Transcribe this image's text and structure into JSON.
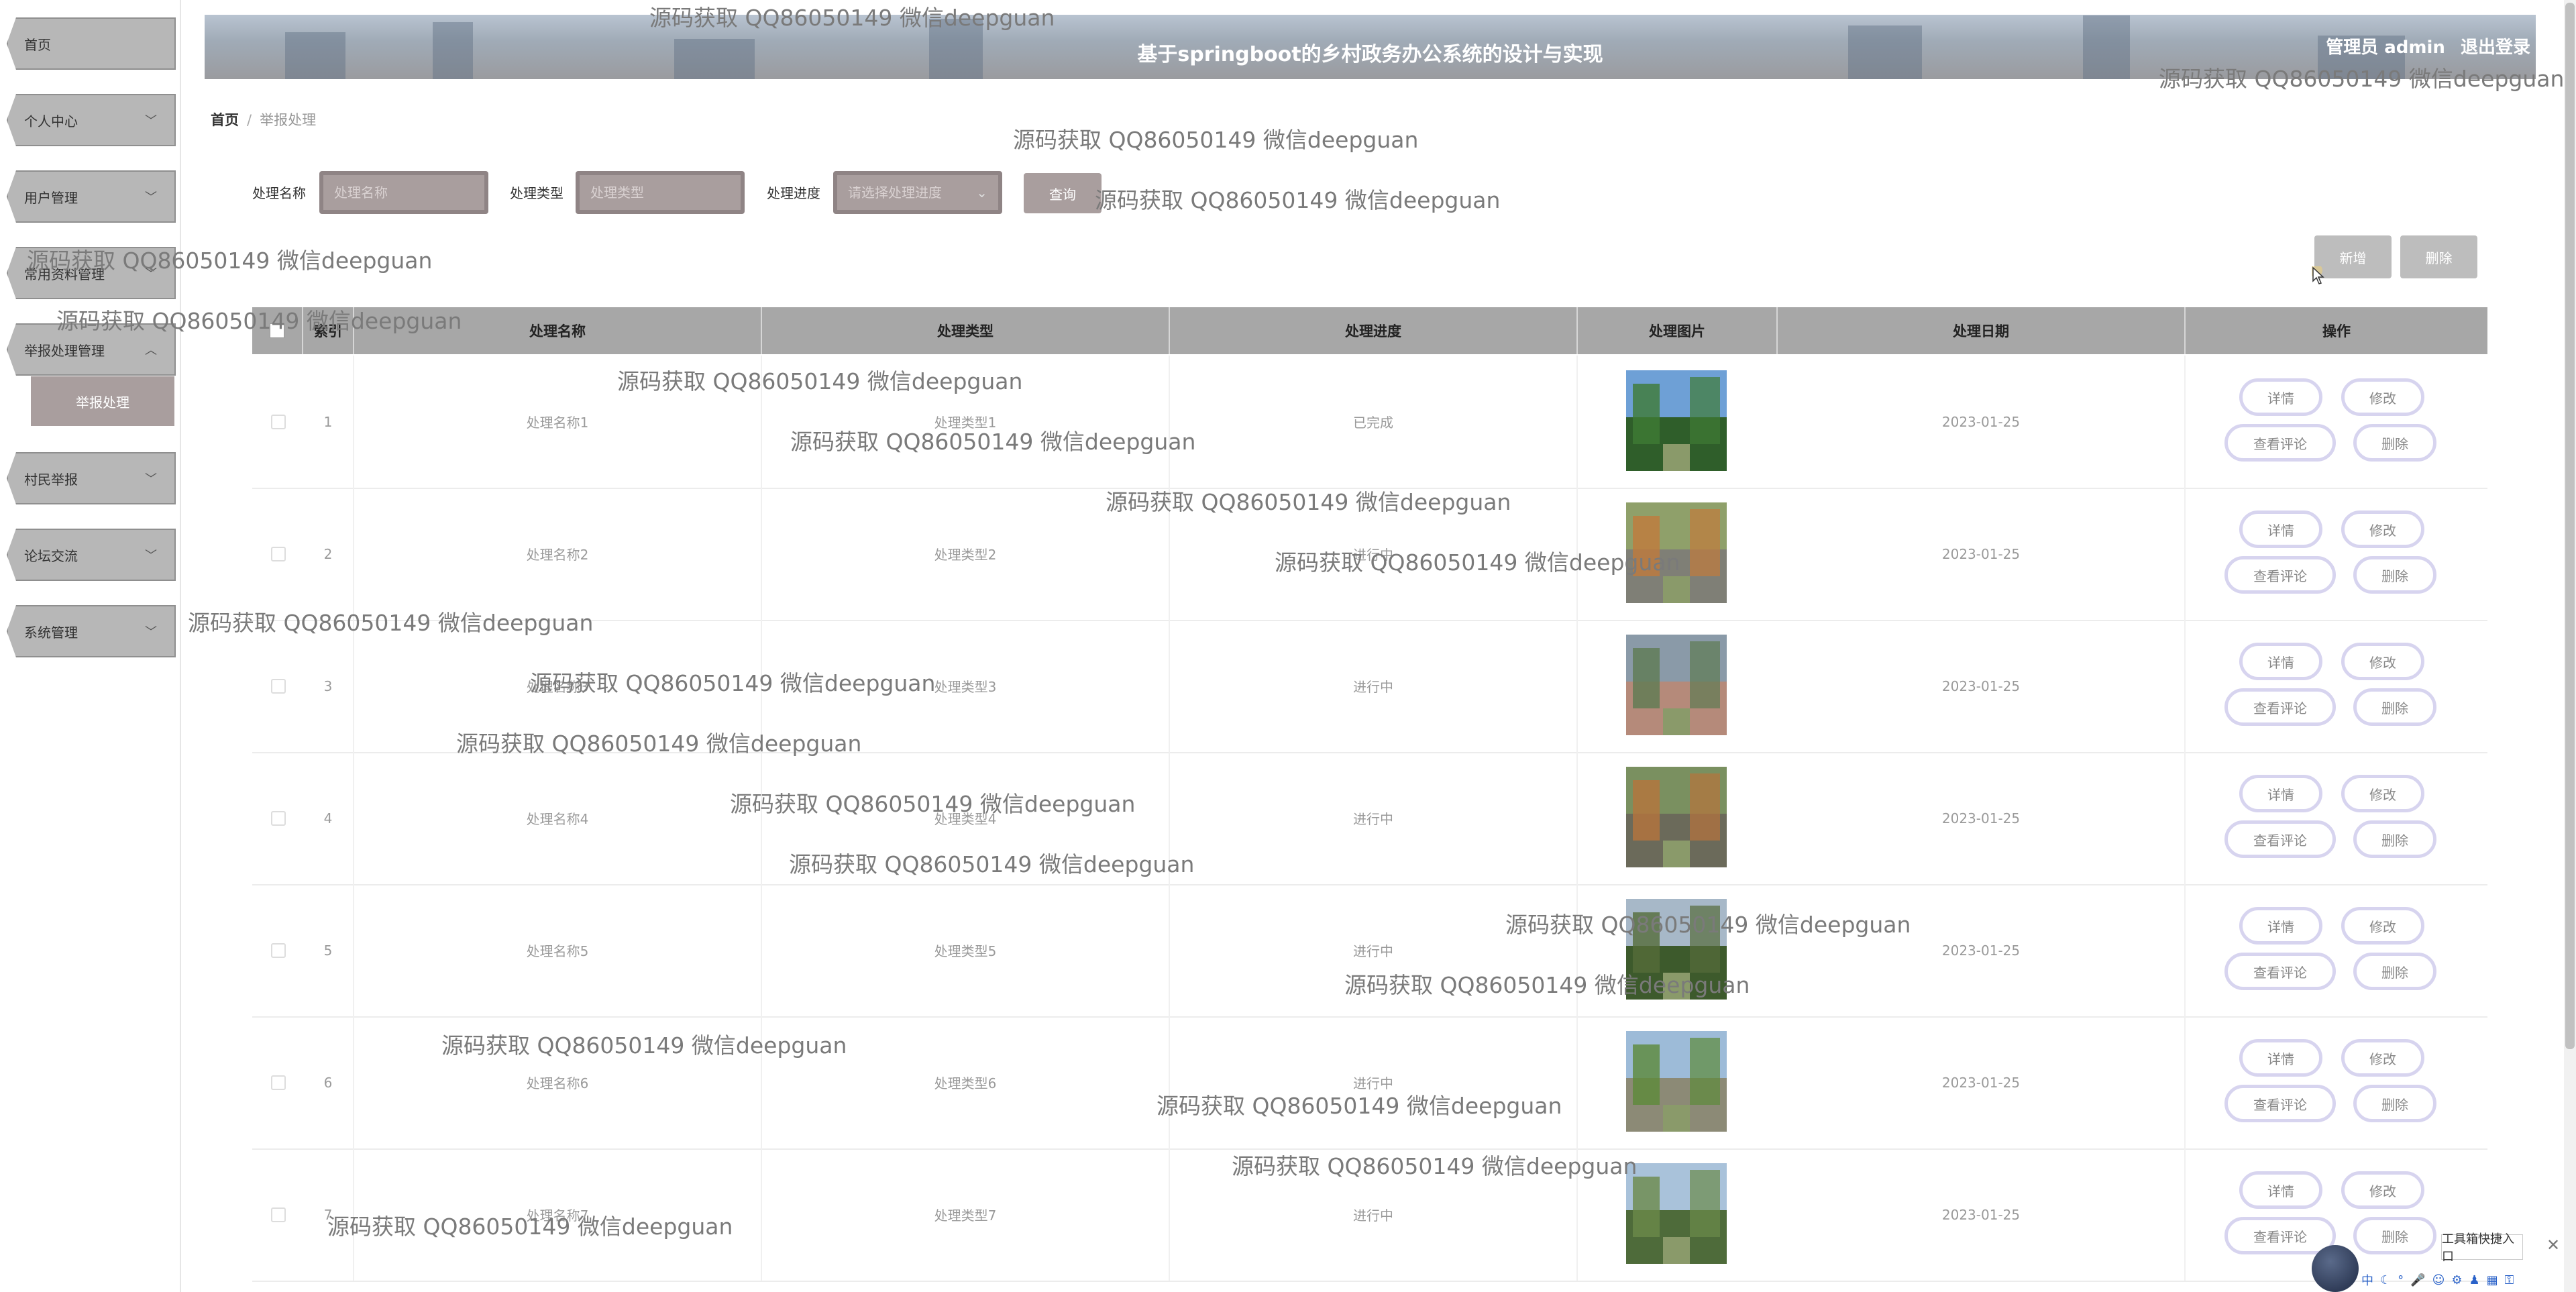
{
  "header": {
    "title": "基于springboot的乡村政务办公系统的设计与实现",
    "admin_label": "管理员 admin",
    "logout_label": "退出登录"
  },
  "sidebar": {
    "items": [
      {
        "label": "首页",
        "has_chevron": false
      },
      {
        "label": "个人中心",
        "has_chevron": true
      },
      {
        "label": "用户管理",
        "has_chevron": true
      },
      {
        "label": "常用资料管理",
        "has_chevron": true
      },
      {
        "label": "举报处理管理",
        "has_chevron": true,
        "expanded": true
      },
      {
        "label": "村民举报",
        "has_chevron": true
      },
      {
        "label": "论坛交流",
        "has_chevron": true
      },
      {
        "label": "系统管理",
        "has_chevron": true
      }
    ],
    "active_sub": "举报处理"
  },
  "breadcrumb": {
    "home": "首页",
    "separator": "/",
    "current": "举报处理"
  },
  "search": {
    "name_label": "处理名称",
    "name_placeholder": "处理名称",
    "type_label": "处理类型",
    "type_placeholder": "处理类型",
    "progress_label": "处理进度",
    "progress_placeholder": "请选择处理进度",
    "query_button": "查询"
  },
  "actions": {
    "add_button": "新增",
    "delete_button": "删除"
  },
  "table": {
    "headers": [
      "索引",
      "处理名称",
      "处理类型",
      "处理进度",
      "处理图片",
      "处理日期",
      "操作"
    ],
    "row_buttons": {
      "detail": "详情",
      "edit": "修改",
      "comments": "查看评论",
      "delete": "删除"
    },
    "rows": [
      {
        "index": "1",
        "name": "处理名称1",
        "type": "处理类型1",
        "progress": "已完成",
        "date": "2023-01-25"
      },
      {
        "index": "2",
        "name": "处理名称2",
        "type": "处理类型2",
        "progress": "进行中",
        "date": "2023-01-25"
      },
      {
        "index": "3",
        "name": "处理名称3",
        "type": "处理类型3",
        "progress": "进行中",
        "date": "2023-01-25"
      },
      {
        "index": "4",
        "name": "处理名称4",
        "type": "处理类型4",
        "progress": "进行中",
        "date": "2023-01-25"
      },
      {
        "index": "5",
        "name": "处理名称5",
        "type": "处理类型5",
        "progress": "进行中",
        "date": "2023-01-25"
      },
      {
        "index": "6",
        "name": "处理名称6",
        "type": "处理类型6",
        "progress": "进行中",
        "date": "2023-01-25"
      },
      {
        "index": "7",
        "name": "处理名称7",
        "type": "处理类型7",
        "progress": "进行中",
        "date": "2023-01-25"
      }
    ]
  },
  "watermark": "源码获取 QQ86050149 微信deepguan",
  "toolbox": {
    "label": "工具箱快捷入口"
  },
  "colors": {
    "accent": "#a99e9e",
    "header_bg": "#9ea9b6",
    "table_head": "#a7a7a7",
    "action_border": "#d7d4ef"
  }
}
